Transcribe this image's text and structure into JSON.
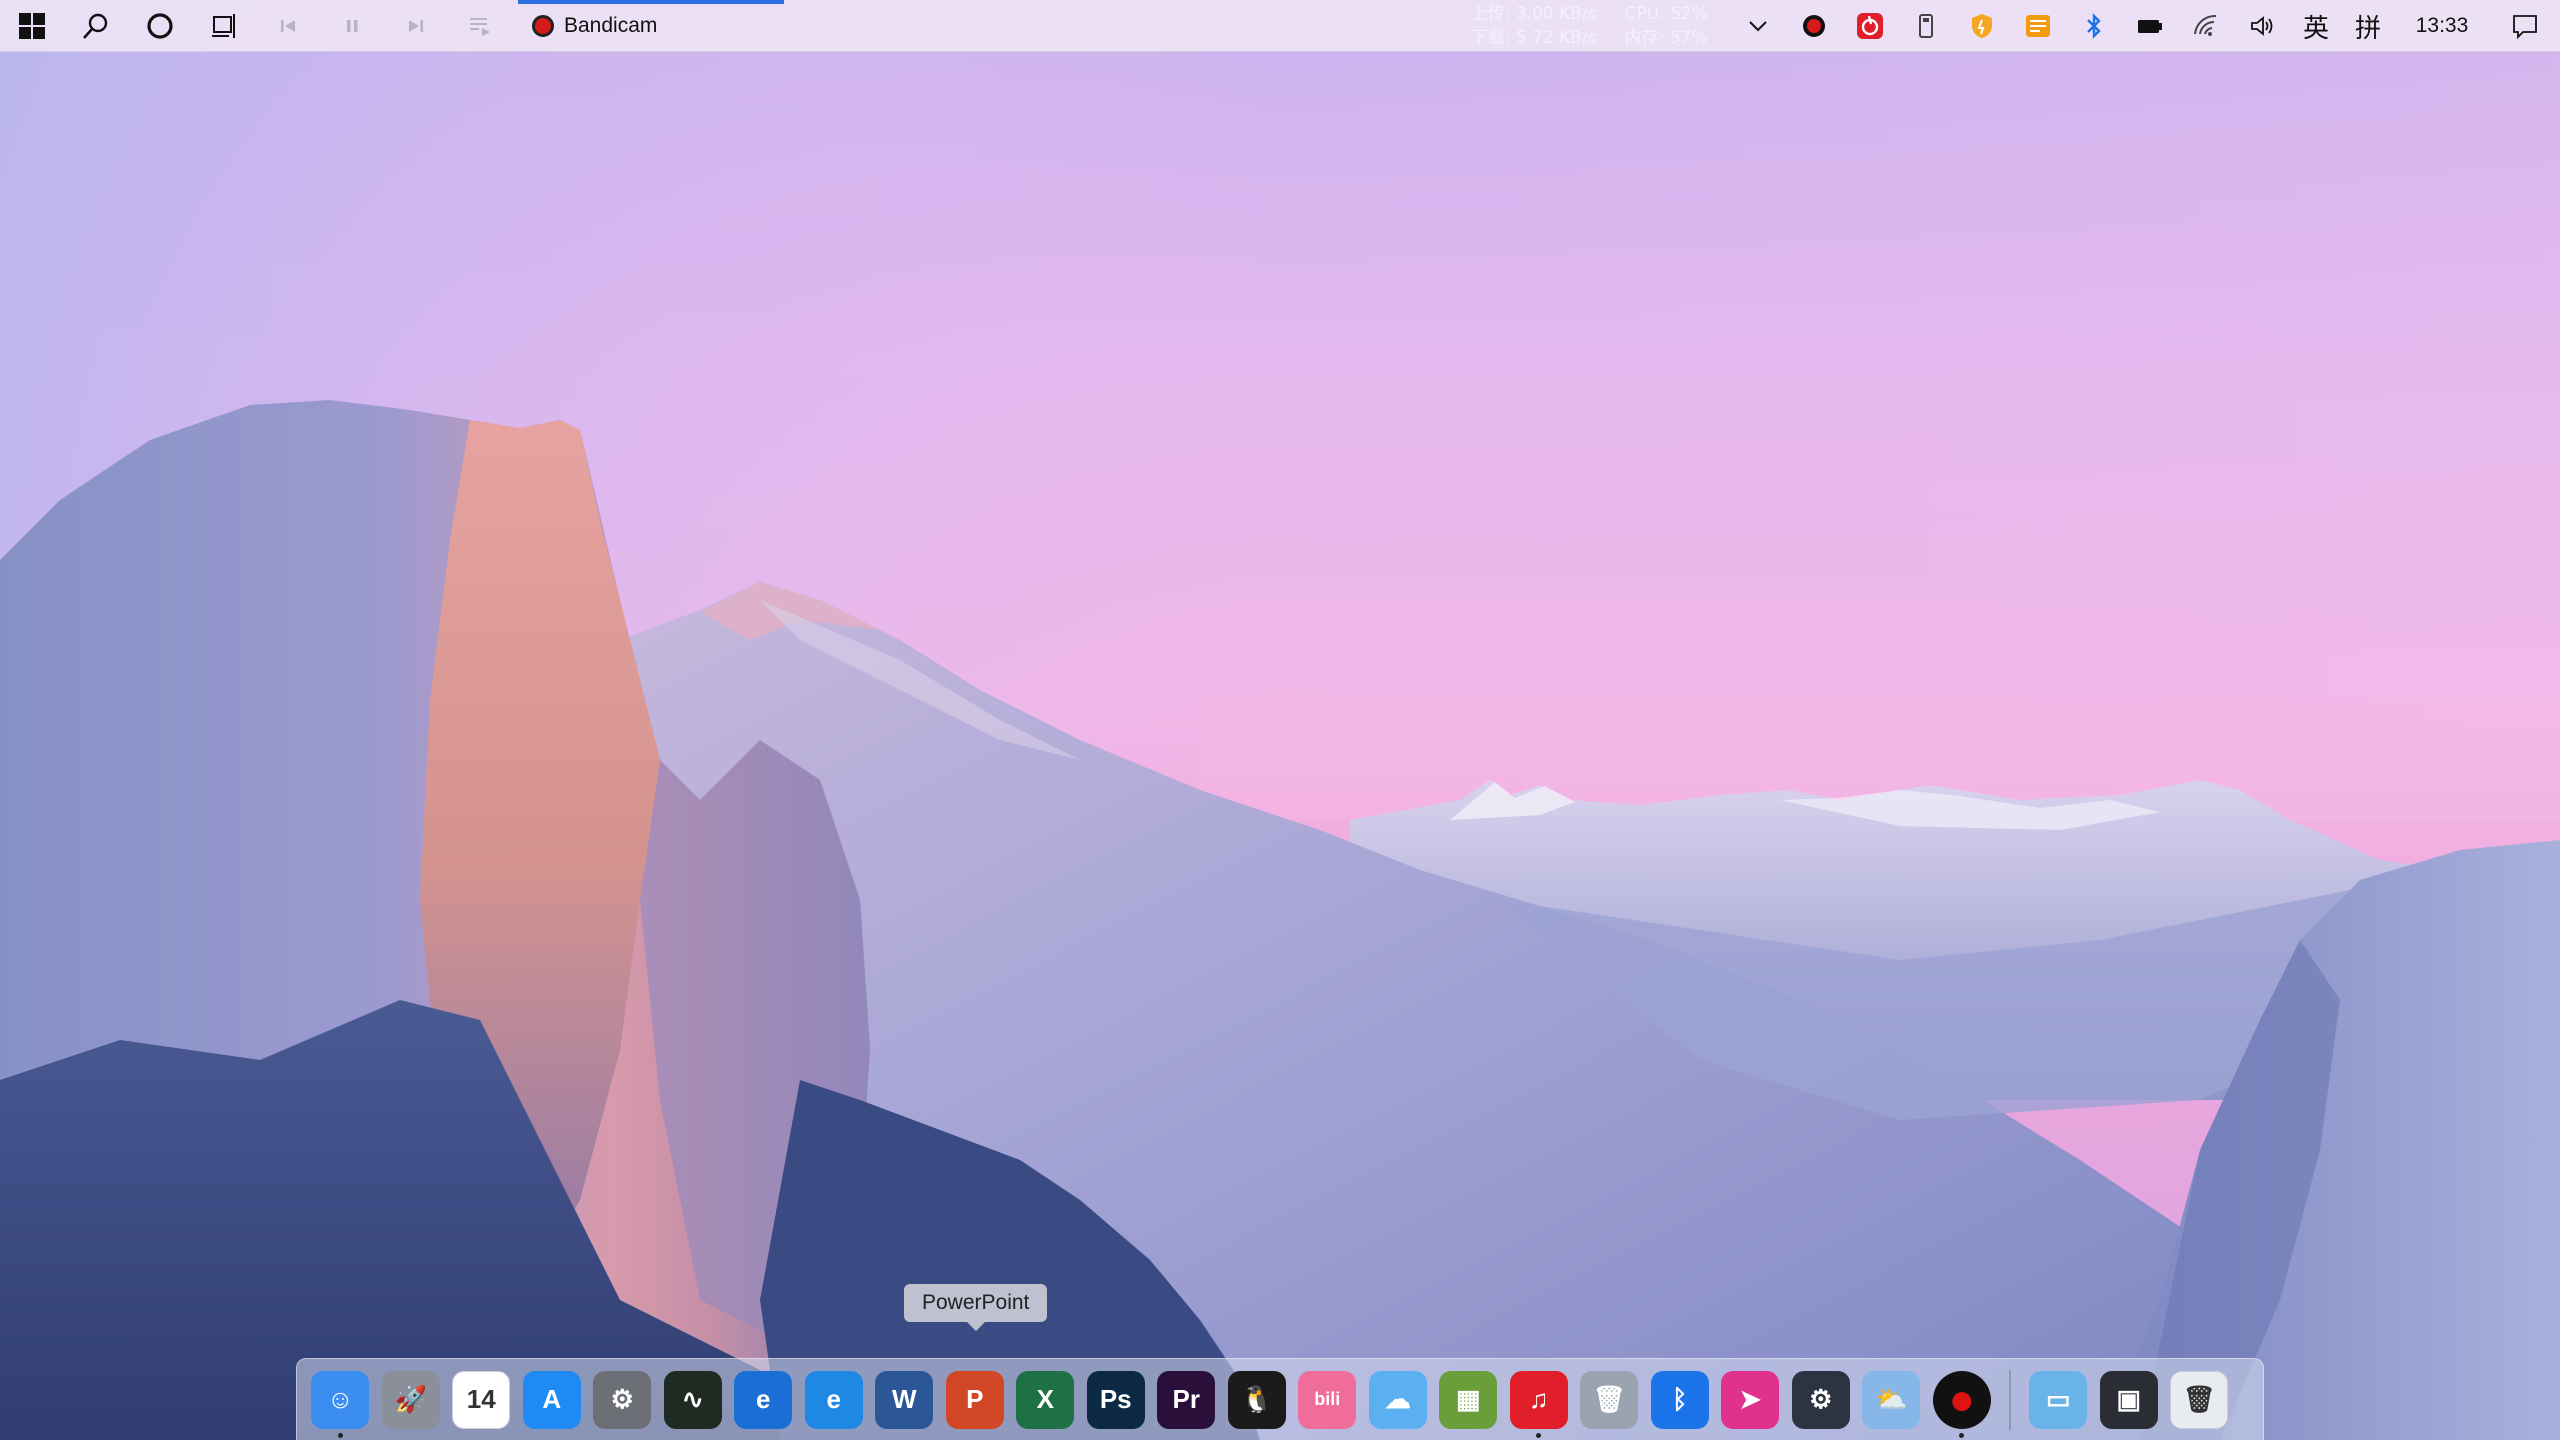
{
  "taskbar": {
    "buttons": [
      {
        "name": "start-button",
        "icon": "windows-logo-icon"
      },
      {
        "name": "search-button",
        "icon": "search-icon"
      },
      {
        "name": "cortana-button",
        "icon": "circle-icon"
      },
      {
        "name": "task-view-button",
        "icon": "task-view-icon"
      },
      {
        "name": "media-previous-button",
        "icon": "skip-previous-icon"
      },
      {
        "name": "media-pause-button",
        "icon": "pause-icon"
      },
      {
        "name": "media-next-button",
        "icon": "skip-next-icon"
      },
      {
        "name": "playlist-button",
        "icon": "playlist-icon"
      }
    ],
    "active_app": {
      "label": "Bandicam",
      "icon": "record-icon"
    },
    "accent_color": "#2c6fe0"
  },
  "netmon": {
    "upload": "上传: 3.00 KB/s",
    "cpu": "CPU: 52%",
    "download": "下载: 5.72 KB/s",
    "memory": "内存: 57%"
  },
  "tray": {
    "icons": [
      "chevron-up-icon",
      "record-icon",
      "netease-music-icon",
      "usb-drive-icon",
      "shield-icon",
      "notes-icon",
      "bluetooth-icon",
      "battery-icon",
      "wifi-icon",
      "volume-icon"
    ],
    "ime_lang": "英",
    "ime_mode": "拼",
    "clock": "13:33",
    "notification_icon": "notification-icon"
  },
  "tooltip": {
    "label": "PowerPoint"
  },
  "dock": {
    "apps": [
      {
        "name": "finder",
        "icon": "finder-icon",
        "color": "#3b8ef0",
        "glyph": "☺",
        "running": true
      },
      {
        "name": "launchpad",
        "icon": "rocket-icon",
        "color": "#8a8f99",
        "glyph": "🚀",
        "running": false
      },
      {
        "name": "calendar",
        "icon": "calendar-icon",
        "color": "#ffffff",
        "glyph": "14",
        "running": false
      },
      {
        "name": "app-store",
        "icon": "app-store-icon",
        "color": "#1e8bf2",
        "glyph": "A",
        "running": false
      },
      {
        "name": "system-preferences",
        "icon": "gear-icon",
        "color": "#6d6f76",
        "glyph": "⚙",
        "running": false
      },
      {
        "name": "activity-monitor",
        "icon": "activity-monitor-icon",
        "color": "#1f2a22",
        "glyph": "∿",
        "running": false
      },
      {
        "name": "internet-explorer",
        "icon": "internet-explorer-icon",
        "color": "#1a6fd6",
        "glyph": "e",
        "running": false
      },
      {
        "name": "edge",
        "icon": "edge-icon",
        "color": "#1e88e5",
        "glyph": "e",
        "running": false
      },
      {
        "name": "word",
        "icon": "word-icon",
        "color": "#2b5797",
        "glyph": "W",
        "running": false
      },
      {
        "name": "powerpoint",
        "icon": "powerpoint-icon",
        "color": "#d24726",
        "glyph": "P",
        "running": false
      },
      {
        "name": "excel",
        "icon": "excel-icon",
        "color": "#1e7145",
        "glyph": "X",
        "running": false
      },
      {
        "name": "photoshop",
        "icon": "photoshop-icon",
        "color": "#0d2a44",
        "glyph": "Ps",
        "running": false
      },
      {
        "name": "premiere",
        "icon": "premiere-icon",
        "color": "#2a0f3a",
        "glyph": "Pr",
        "running": false
      },
      {
        "name": "qq",
        "icon": "penguin-icon",
        "color": "#1b1b1b",
        "glyph": "🐧",
        "running": false
      },
      {
        "name": "bilibili",
        "icon": "bilibili-icon",
        "color": "#f06c9a",
        "glyph": "bili",
        "running": false
      },
      {
        "name": "icloud",
        "icon": "cloud-icon",
        "color": "#5ab0f0",
        "glyph": "☁",
        "running": false
      },
      {
        "name": "minecraft",
        "icon": "grass-block-icon",
        "color": "#6a9e3a",
        "glyph": "▦",
        "running": false
      },
      {
        "name": "netease-music",
        "icon": "netease-music-icon",
        "color": "#e01f2b",
        "glyph": "♫",
        "running": true
      },
      {
        "name": "trash-can-app",
        "icon": "bin-icon",
        "color": "#9aa4b0",
        "glyph": "🗑",
        "running": false
      },
      {
        "name": "bluetooth",
        "icon": "bluetooth-icon",
        "color": "#1a73e8",
        "glyph": "ᛒ",
        "running": false
      },
      {
        "name": "send-arrow",
        "icon": "send-icon",
        "color": "#e0328c",
        "glyph": "➤",
        "running": false
      },
      {
        "name": "settings-gear",
        "icon": "cog-icon",
        "color": "#2b3440",
        "glyph": "⚙",
        "running": false
      },
      {
        "name": "weather",
        "icon": "weather-icon",
        "color": "#87b7e8",
        "glyph": "⛅",
        "running": false
      },
      {
        "name": "bandicam",
        "icon": "record-icon",
        "color": "#111111",
        "glyph": "●",
        "running": true
      }
    ],
    "stack": [
      {
        "name": "folder",
        "icon": "folder-icon",
        "color": "#6ab3ea",
        "glyph": "▭"
      },
      {
        "name": "screenshot",
        "icon": "screen-capture-icon",
        "color": "#2a2d33",
        "glyph": "▣"
      },
      {
        "name": "trash",
        "icon": "trash-icon",
        "color": "#e8ecf0",
        "glyph": "🗑"
      }
    ]
  }
}
